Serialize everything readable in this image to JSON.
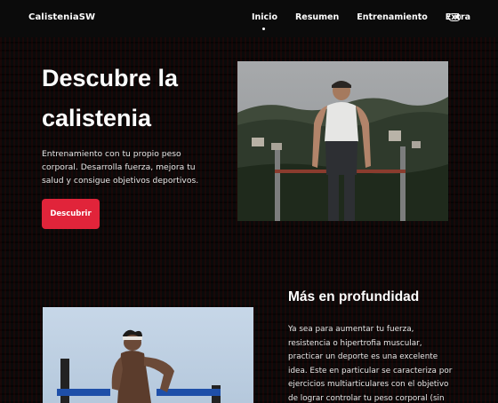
{
  "header": {
    "brand": "CalisteniaSW",
    "nav": [
      "Inicio",
      "Resumen",
      "Entrenamiento",
      "Extra"
    ],
    "active_nav": "Inicio",
    "theme_toggle_icon": "toggle-switch-icon"
  },
  "hero": {
    "title_line1": "Descubre la",
    "title_line2": "calistenia",
    "text": "Entrenamiento con tu propio peso corporal. Desarrolla fuerza, mejora tu salud y consigue objetivos deportivos.",
    "cta_label": "Descubrir",
    "cta_color": "#e1243a"
  },
  "section": {
    "title": "Más en profundidad",
    "text": "Ya sea para aumentar tu fuerza, resistencia o hipertrofia muscular, practicar un deporte es una excelente idea. Este en particular se caracteriza por ejercicios multiarticulares con el objetivo de lograr controlar tu peso corporal (sin necesidad de mucho"
  },
  "colors": {
    "accent": "#e1243a",
    "background": "#0a0a0a"
  }
}
